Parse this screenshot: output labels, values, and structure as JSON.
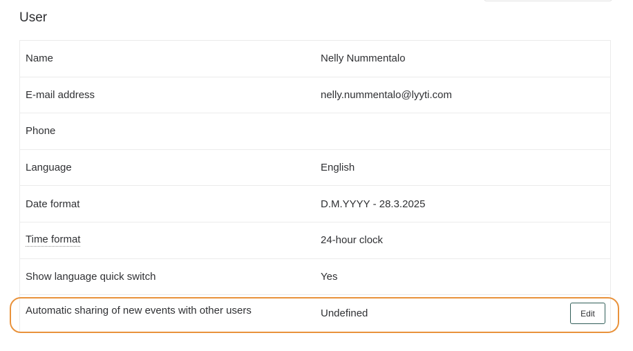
{
  "section": {
    "title": "User"
  },
  "rows": [
    {
      "label": "Name",
      "value": "Nelly Nummentalo"
    },
    {
      "label": "E-mail address",
      "value": "nelly.nummentalo@lyyti.com"
    },
    {
      "label": "Phone",
      "value": ""
    },
    {
      "label": "Language",
      "value": "English"
    },
    {
      "label": "Date format",
      "value": "D.M.YYYY - 28.3.2025"
    },
    {
      "label": "Time format",
      "value": "24-hour clock"
    },
    {
      "label": "Show language quick switch",
      "value": "Yes"
    },
    {
      "label": "Automatic sharing of new events with other users",
      "value": "Undefined"
    }
  ],
  "actions": {
    "edit_label": "Edit"
  },
  "colors": {
    "highlight": "#e9923b",
    "button_border": "#2f5d57",
    "row_border": "#ebebeb"
  }
}
